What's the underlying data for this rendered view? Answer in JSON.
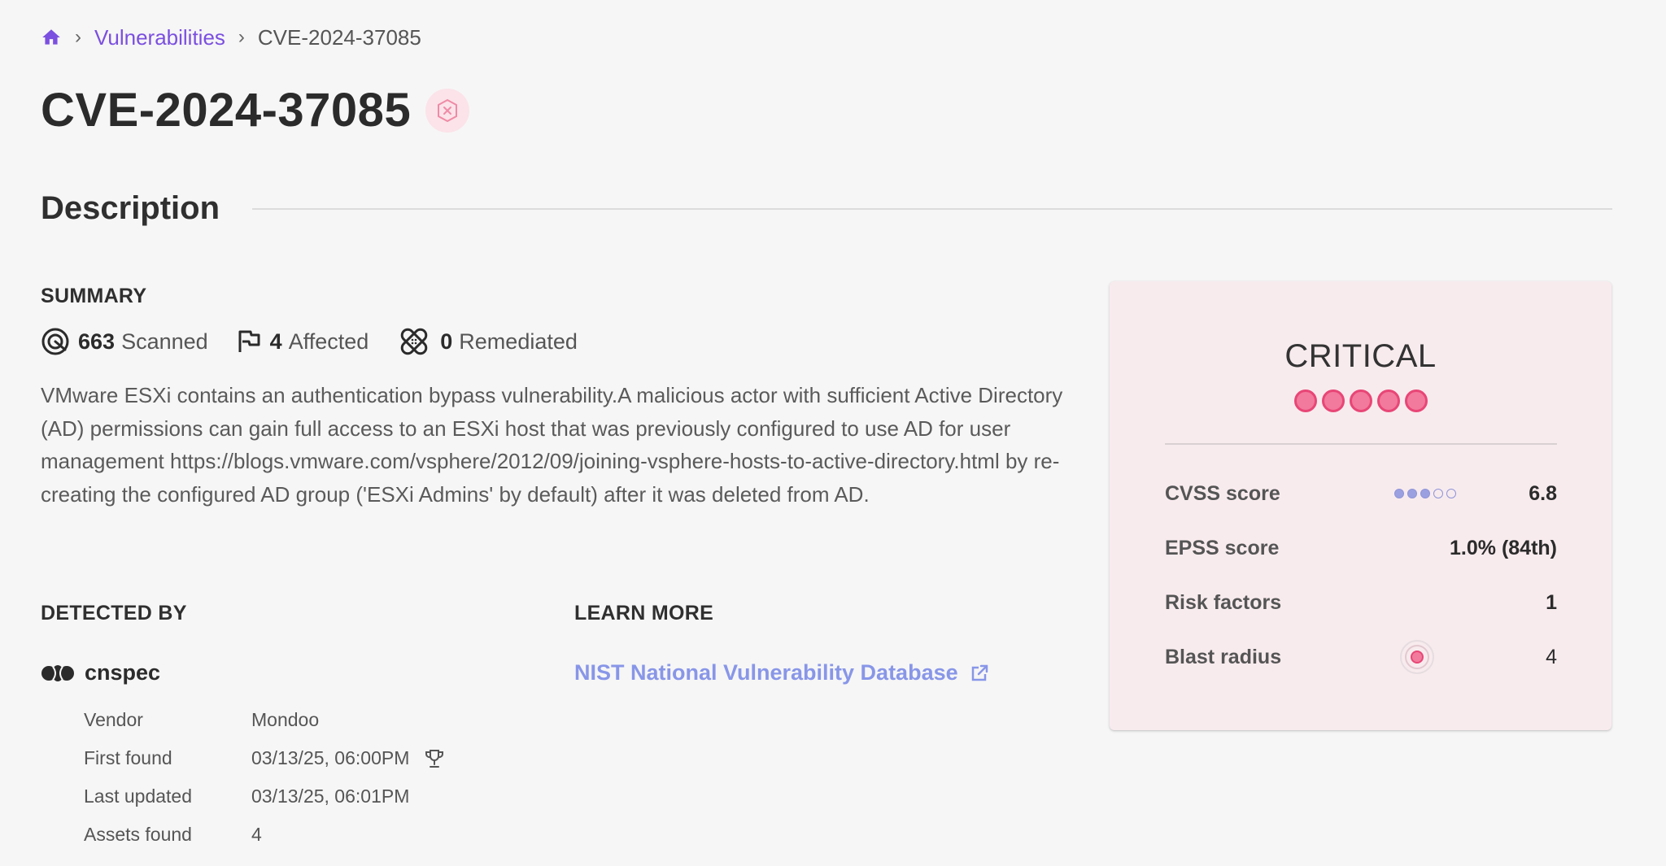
{
  "breadcrumb": {
    "icon": "home-icon",
    "parent": "Vulnerabilities",
    "current": "CVE-2024-37085"
  },
  "title": "CVE-2024-37085",
  "description_section": {
    "heading": "Description",
    "summary_label": "SUMMARY",
    "stats": {
      "scanned_count": "663",
      "scanned_label": "Scanned",
      "affected_count": "4",
      "affected_label": "Affected",
      "remediated_count": "0",
      "remediated_label": "Remediated"
    },
    "text": "VMware ESXi contains an authentication bypass vulnerability.A malicious actor with sufficient Active Directory (AD) permissions can gain full access to an ESXi host that was previously configured to use AD for user management https://blogs.vmware.com/vsphere/2012/09/joining-vsphere-hosts-to-active-directory.html by re-creating the configured AD group ('ESXi Admins' by default) after it was deleted from AD."
  },
  "detected_by": {
    "label": "DETECTED BY",
    "tool": "cnspec",
    "rows": [
      {
        "key": "Vendor",
        "value": "Mondoo"
      },
      {
        "key": "First found",
        "value": "03/13/25, 06:00PM"
      },
      {
        "key": "Last updated",
        "value": "03/13/25, 06:01PM"
      },
      {
        "key": "Assets found",
        "value": "4"
      }
    ]
  },
  "learn_more": {
    "label": "LEARN MORE",
    "link_text": "NIST National Vulnerability Database"
  },
  "severity_card": {
    "level": "CRITICAL",
    "level_dots": 5,
    "metrics": {
      "cvss_label": "CVSS score",
      "cvss_value": "6.8",
      "cvss_dots_filled": 3,
      "cvss_dots_total": 5,
      "epss_label": "EPSS score",
      "epss_value": "1.0% (84th)",
      "risk_label": "Risk factors",
      "risk_value": "1",
      "blast_label": "Blast radius",
      "blast_value": "4"
    }
  },
  "colors": {
    "accent": "#7b4fe0",
    "link": "#8896e8",
    "critical": "#e84676",
    "card_bg": "#f8ebee"
  }
}
